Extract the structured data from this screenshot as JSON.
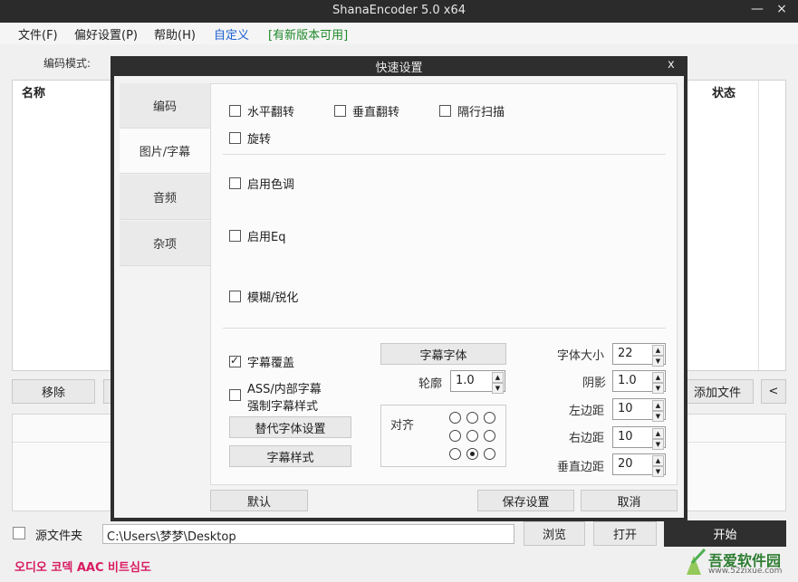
{
  "window": {
    "title": "ShanaEncoder 5.0 x64",
    "min": "—",
    "close": "×"
  },
  "menu": [
    "文件(F)",
    "偏好设置(P)",
    "帮助(H)",
    "自定义",
    "[有新版本可用]"
  ],
  "menu_colors": {
    "custom": "#1a5fd1",
    "update": "#1f8a2a"
  },
  "toolbar": {
    "encode_mode_label": "编码模式:"
  },
  "file_list": {
    "col_name": "名称",
    "col_status": "状态"
  },
  "buttons": {
    "remove": "移除",
    "add_file": "添加文件",
    "collapse": "<"
  },
  "bottom": {
    "source_folder_label": "源文件夹",
    "path": "C:\\Users\\梦梦\\Desktop",
    "browse": "浏览",
    "open": "打开",
    "start": "开始"
  },
  "status_text": "오디오 코덱 AAC 비트심도",
  "watermark": {
    "brand": "吾爱软件园",
    "url": "www.52zixue.com"
  },
  "dialog": {
    "title": "快速设置",
    "close": "x",
    "nav": [
      "编码",
      "图片/字幕",
      "音频",
      "杂项"
    ],
    "active_nav": 1,
    "video": {
      "hflip": "水平翻转",
      "vflip": "垂直翻转",
      "interlace": "隔行扫描",
      "rotate": "旋转",
      "color": "启用色调",
      "eq": "启用Eq",
      "blur": "模糊/锐化"
    },
    "subtitle": {
      "overlay": "字幕覆盖",
      "ass_line1": "ASS/内部字幕",
      "ass_line2": "强制字幕样式",
      "replace_font": "替代字体设置",
      "sub_style": "字幕样式",
      "sub_font": "字幕字体",
      "outline_label": "轮廓",
      "outline_value": "1.0",
      "align_label": "对齐",
      "align_selected": 7,
      "font_size_label": "字体大小",
      "font_size_value": "22",
      "shadow_label": "阴影",
      "shadow_value": "1.0",
      "left_margin_label": "左边距",
      "left_margin_value": "10",
      "right_margin_label": "右边距",
      "right_margin_value": "10",
      "vertical_margin_label": "垂直边距",
      "vertical_margin_value": "20"
    },
    "footer": {
      "default": "默认",
      "save": "保存设置",
      "cancel": "取消"
    }
  }
}
